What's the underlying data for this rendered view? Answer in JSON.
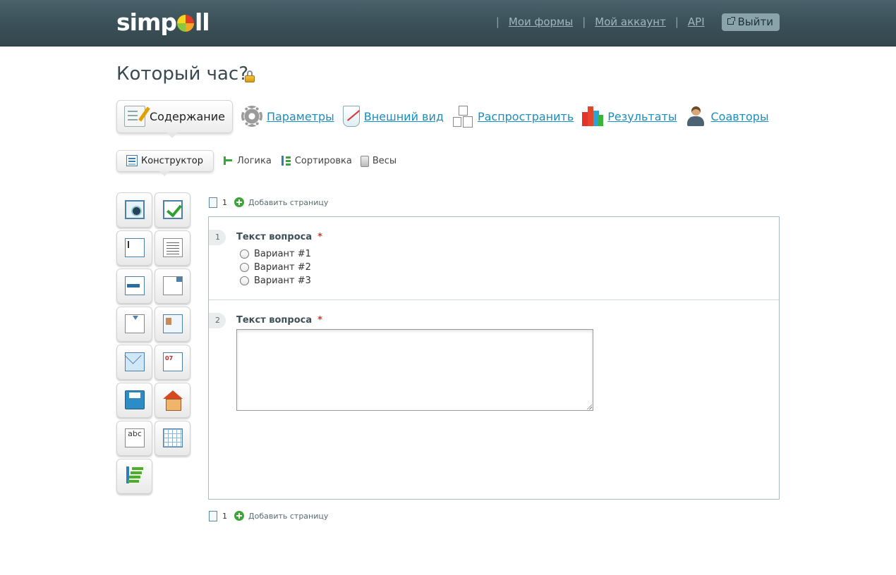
{
  "header": {
    "logo_text_1": "simp",
    "logo_text_2": "ll",
    "nav": [
      {
        "label": "Мои формы"
      },
      {
        "label": "Мой аккаунт"
      },
      {
        "label": "API"
      }
    ],
    "separator": "|",
    "logout_label": "Выйти"
  },
  "page": {
    "title": "Который час?"
  },
  "main_tabs": {
    "active": {
      "label": "Содержание",
      "icon": "edit-icon"
    },
    "items": [
      {
        "label": "Параметры",
        "icon": "gear-icon"
      },
      {
        "label": "Внешний вид",
        "icon": "appearance-icon"
      },
      {
        "label": "Распространить",
        "icon": "share-icon"
      },
      {
        "label": "Результаты",
        "icon": "results-chart-icon"
      },
      {
        "label": "Соавторы",
        "icon": "coauthors-icon"
      }
    ]
  },
  "sub_tabs": {
    "active": {
      "label": "Конструктор",
      "icon": "constructor-icon"
    },
    "items": [
      {
        "label": "Логика",
        "icon": "logic-icon"
      },
      {
        "label": "Сортировка",
        "icon": "sort-icon"
      },
      {
        "label": "Весы",
        "icon": "weights-icon"
      }
    ]
  },
  "toolbox": {
    "tools": [
      {
        "icon": "radio-button-icon"
      },
      {
        "icon": "checkbox-icon"
      },
      {
        "icon": "text-input-icon"
      },
      {
        "icon": "textarea-icon"
      },
      {
        "icon": "listbox-icon"
      },
      {
        "icon": "select-icon"
      },
      {
        "icon": "dropdown-icon"
      },
      {
        "icon": "contact-card-icon"
      },
      {
        "icon": "email-icon"
      },
      {
        "icon": "date-icon",
        "text": "07"
      },
      {
        "icon": "save-icon"
      },
      {
        "icon": "address-house-icon"
      },
      {
        "icon": "static-text-icon",
        "text": "abc"
      },
      {
        "icon": "matrix-grid-icon"
      },
      {
        "icon": "ranking-icon"
      }
    ]
  },
  "page_bar": {
    "page_number": "1",
    "add_page_label": "Добавить страницу"
  },
  "questions": [
    {
      "number": "1",
      "title": "Текст вопроса",
      "required_mark": "*",
      "options": [
        "Вариант #1",
        "Вариант #2",
        "Вариант #3"
      ]
    },
    {
      "number": "2",
      "title": "Текст вопроса",
      "required_mark": "*",
      "answer_value": ""
    }
  ],
  "colors": {
    "header_bg": "#3a4f57",
    "link": "#1a8ec2",
    "required": "#d8322c"
  }
}
